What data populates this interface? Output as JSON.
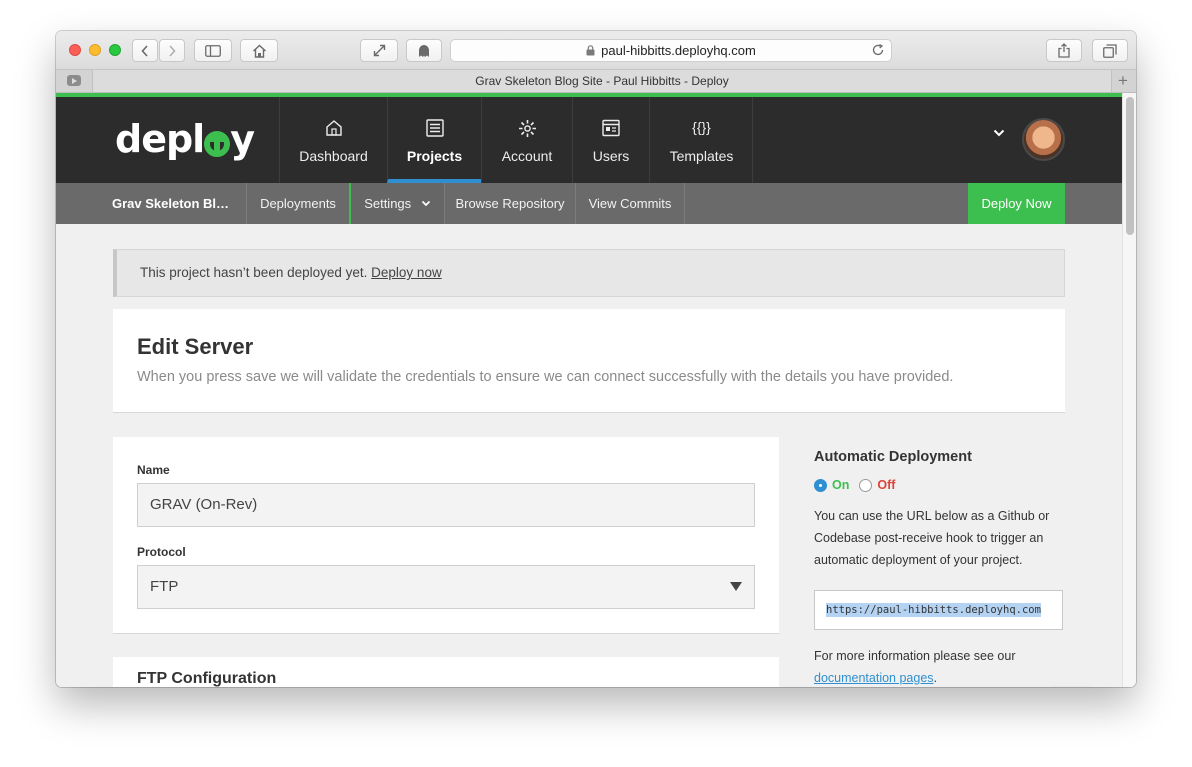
{
  "browser": {
    "url": "paul-hibbitts.deployhq.com",
    "tab_title": "Grav Skeleton Blog Site - Paul Hibbitts - Deploy"
  },
  "header": {
    "logo_text_a": "depl",
    "logo_text_b": "y",
    "nav": [
      {
        "label": "Dashboard",
        "icon": "house-icon",
        "active": false
      },
      {
        "label": "Projects",
        "icon": "project-list-icon",
        "active": true
      },
      {
        "label": "Account",
        "icon": "gear-icon",
        "active": false
      },
      {
        "label": "Users",
        "icon": "users-card-icon",
        "active": false
      },
      {
        "label": "Templates",
        "icon": "braces-icon",
        "active": false
      }
    ],
    "templates_glyph": "{{}}"
  },
  "subnav": {
    "project_name": "Grav Skeleton Bl…",
    "items": [
      "Deployments",
      "Settings",
      "Browse Repository",
      "View Commits"
    ],
    "deploy_now": "Deploy Now"
  },
  "notice": {
    "text": "This project hasn’t been deployed yet.",
    "link": "Deploy now"
  },
  "edit_server": {
    "title": "Edit Server",
    "subtitle": "When you press save we will validate the credentials to ensure we can connect successfully with the details you have provided."
  },
  "form": {
    "name_label": "Name",
    "name_value": "GRAV (On-Rev)",
    "protocol_label": "Protocol",
    "protocol_value": "FTP",
    "ftp_section_title": "FTP Configuration"
  },
  "auto_deploy": {
    "title": "Automatic Deployment",
    "on_label": "On",
    "off_label": "Off",
    "selected": "On",
    "description": "You can use the URL below as a Github or Codebase post-receive hook to trigger an automatic deployment of your project.",
    "hook_url": "https://paul-hibbitts.deployhq.com",
    "more_info_text": "For more information please see our",
    "more_info_link": "documentation pages",
    "more_info_end": "."
  },
  "colors": {
    "brand_green": "#3dbf4f",
    "active_blue": "#2f8fd0",
    "nav_dark": "#2c2c2c",
    "subnav_gray": "#6a6a6a",
    "off_red": "#d9443a"
  }
}
